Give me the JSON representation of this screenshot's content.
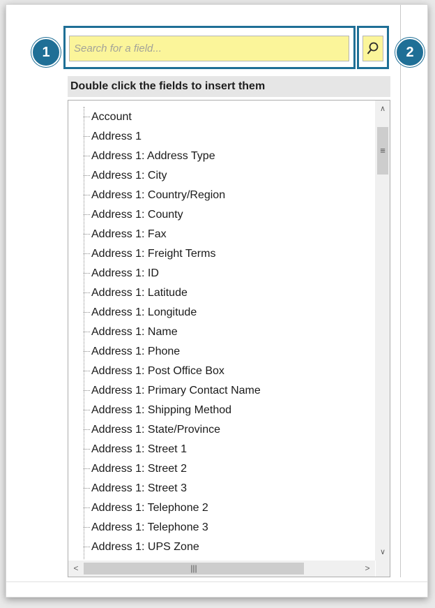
{
  "search": {
    "placeholder": "Search for a field...",
    "button_icon": "search-icon"
  },
  "callouts": [
    "1",
    "2"
  ],
  "instruction": "Double click the fields to insert them",
  "fields": [
    "Account",
    "Address 1",
    "Address 1: Address Type",
    "Address 1: City",
    "Address 1: Country/Region",
    "Address 1: County",
    "Address 1: Fax",
    "Address 1: Freight Terms",
    "Address 1: ID",
    "Address 1: Latitude",
    "Address 1: Longitude",
    "Address 1: Name",
    "Address 1: Phone",
    "Address 1: Post Office Box",
    "Address 1: Primary Contact Name",
    "Address 1: Shipping Method",
    "Address 1: State/Province",
    "Address 1: Street 1",
    "Address 1: Street 2",
    "Address 1: Street 3",
    "Address 1: Telephone 2",
    "Address 1: Telephone 3",
    "Address 1: UPS Zone"
  ],
  "colors": {
    "callout": "#1f6f96",
    "search_highlight": "#fbf59a"
  }
}
